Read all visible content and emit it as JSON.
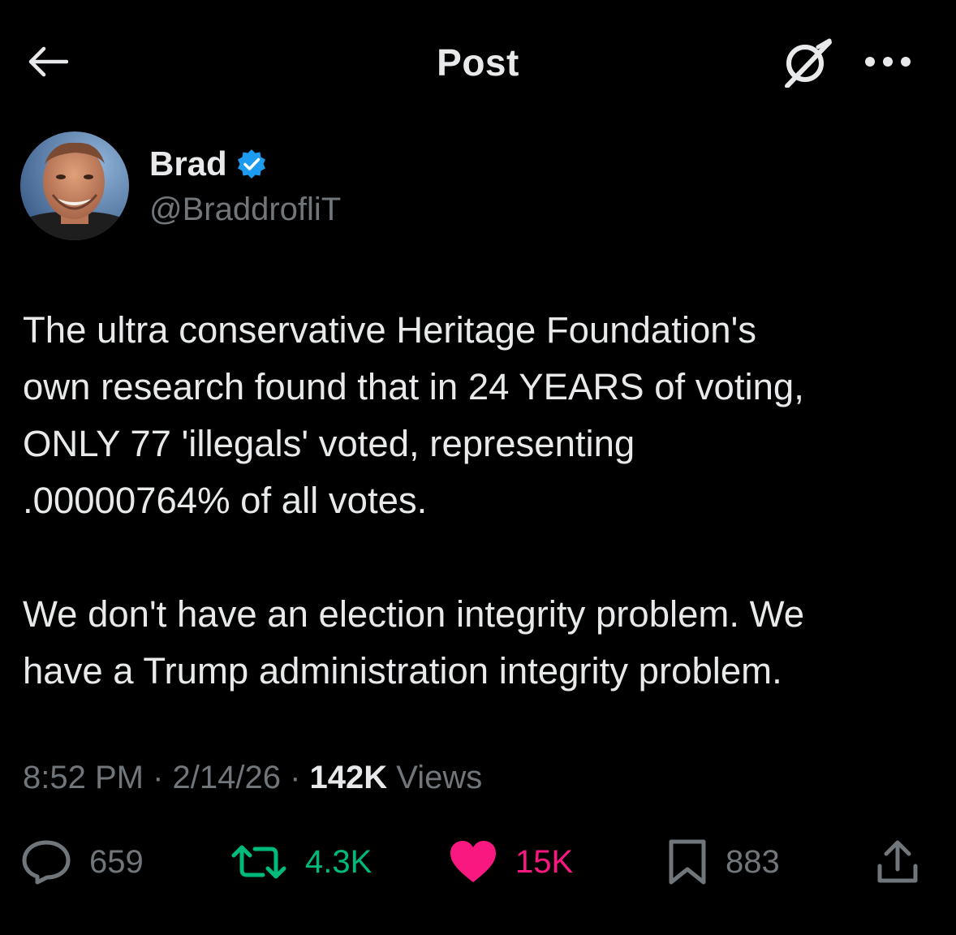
{
  "header": {
    "title": "Post",
    "back_icon": "arrow-left-icon",
    "grok_icon": "grok-icon",
    "more_icon": "more-dots-icon"
  },
  "author": {
    "name": "Brad",
    "handle": "@BraddrofliT",
    "verified": true,
    "verified_color": "#1d9bf0"
  },
  "tweet": {
    "paragraphs": [
      "The ultra conservative Heritage Foundation's\nown research found that in 24 YEARS of voting,\nONLY 77 'illegals' voted, representing\n.00000764% of all votes.",
      "We don't have an election integrity problem.  We\nhave a Trump administration integrity problem."
    ]
  },
  "meta": {
    "time": "8:52 PM",
    "separator": " · ",
    "date": "2/14/26",
    "views_count": "142K",
    "views_label": " Views"
  },
  "actions": {
    "replies": {
      "count": "659",
      "icon": "reply-icon",
      "color": "#71767b"
    },
    "retweets": {
      "count": "4.3K",
      "icon": "retweet-icon",
      "color": "#00ba7c"
    },
    "likes": {
      "count": "15K",
      "icon": "heart-icon",
      "color": "#f91880"
    },
    "bookmarks": {
      "count": "883",
      "icon": "bookmark-icon",
      "color": "#71767b"
    },
    "share": {
      "icon": "share-icon"
    }
  },
  "colors": {
    "background": "#000000",
    "text_primary": "#e7e9ea",
    "text_secondary": "#71767b"
  }
}
